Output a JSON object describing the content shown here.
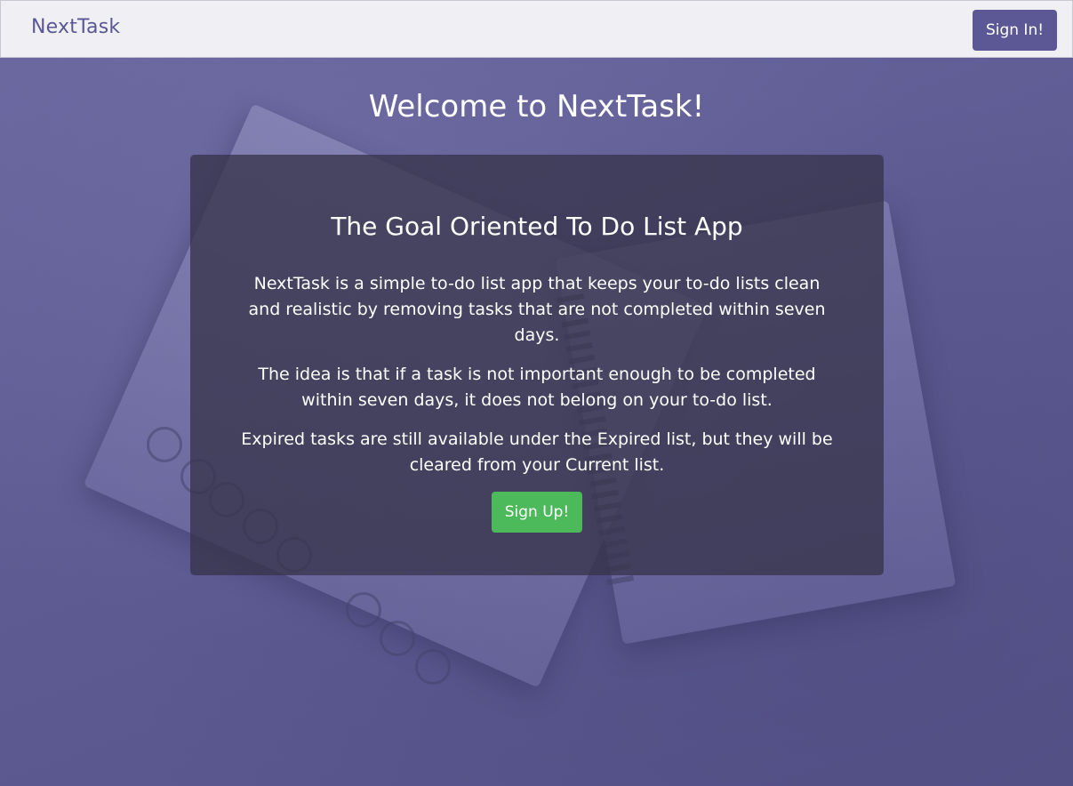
{
  "navbar": {
    "brand": "NextTask",
    "signin_label": "Sign In!"
  },
  "hero": {
    "heading": "Welcome to NextTask!"
  },
  "card": {
    "title": "The Goal Oriented To Do List App",
    "paragraphs": [
      "NextTask is a simple to-do list app that keeps your to-do lists clean and realistic by removing tasks that are not completed within seven days.",
      "The idea is that if a task is not important enough to be completed within seven days, it does not belong on your to-do list.",
      "Expired tasks are still available under the Expired list, but they will be cleared from your Current list."
    ],
    "signup_label": "Sign Up!"
  },
  "colors": {
    "brand_purple": "#5b5895",
    "background_purple": "#5f5c93",
    "signup_green": "#4cb95a",
    "navbar_bg": "#f0eff4"
  }
}
